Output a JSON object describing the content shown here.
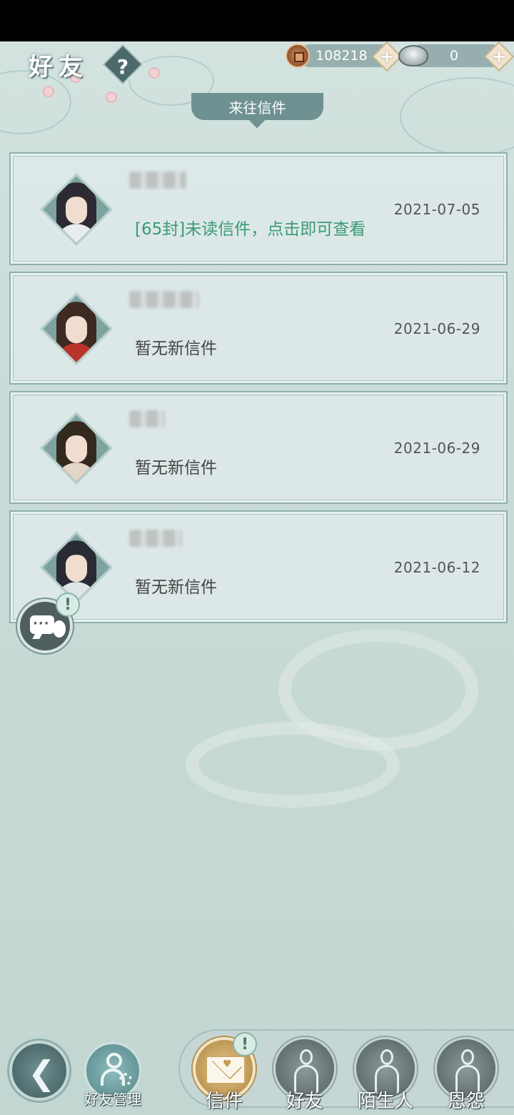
{
  "header": {
    "title": "好友",
    "help_label": "?",
    "section_title": "来往信件"
  },
  "currency": {
    "copper": "108218",
    "silver": "0",
    "add_label": "+"
  },
  "mails": [
    {
      "status": "[65封]未读信件，点击即可查看",
      "date": "2021-07-05",
      "unread": true
    },
    {
      "status": "暂无新信件",
      "date": "2021-06-29",
      "unread": false
    },
    {
      "status": "暂无新信件",
      "date": "2021-06-29",
      "unread": false
    },
    {
      "status": "暂无新信件",
      "date": "2021-06-12",
      "unread": false
    }
  ],
  "float_chat": {
    "badge": "!"
  },
  "bottom": {
    "back_icon": "back-arrow-icon",
    "manage_label": "好友管理",
    "tabs": [
      {
        "label": "信件",
        "active": true,
        "badge": "!"
      },
      {
        "label": "好友",
        "active": false
      },
      {
        "label": "陌生人",
        "active": false
      },
      {
        "label": "恩怨",
        "active": false
      }
    ]
  },
  "colors": {
    "unread_text": "#3b9a73",
    "active_tab": "#d2b06c",
    "section_header": "#6f9191"
  }
}
